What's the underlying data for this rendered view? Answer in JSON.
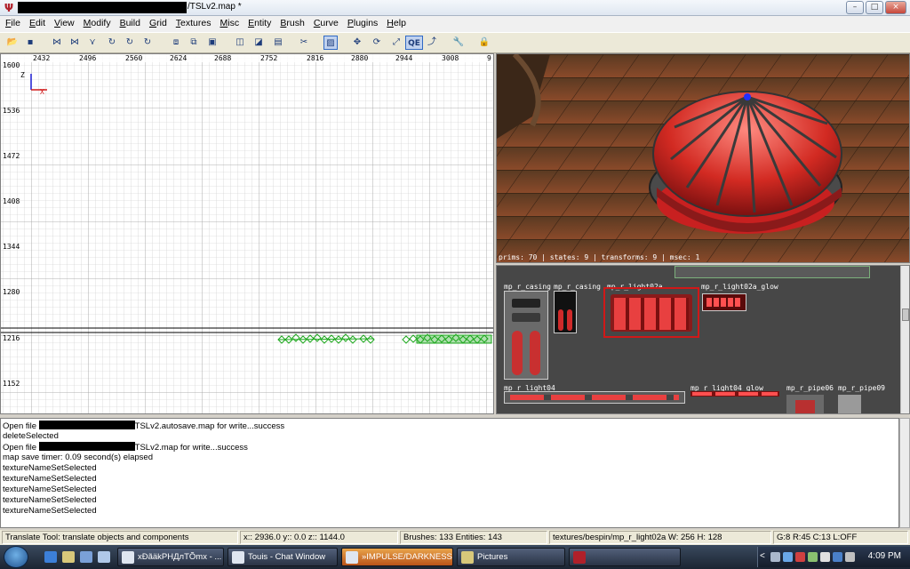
{
  "window": {
    "title": "/TSLv2.map *",
    "buttons": {
      "minimize": "–",
      "maximize": "□",
      "close": "×"
    }
  },
  "menu": [
    "File",
    "Edit",
    "View",
    "Modify",
    "Build",
    "Grid",
    "Textures",
    "Misc",
    "Entity",
    "Brush",
    "Curve",
    "Plugins",
    "Help"
  ],
  "toolbar": {
    "icons": [
      "open-icon",
      "save-icon",
      "flip-x-icon",
      "flip-y-icon",
      "flip-z-icon",
      "rotate-x-icon",
      "rotate-y-icon",
      "rotate-z-icon",
      "select-complete-tall-icon",
      "select-touching-icon",
      "select-inside-icon",
      "csg-subtract-icon",
      "csg-merge-icon",
      "make-hollow-icon",
      "clipper-icon",
      "camera-view-icon",
      "translate-icon",
      "rotate-icon",
      "scale-icon",
      "qe-mode-icon",
      "drag-vertices-icon",
      "texture-lock-icon",
      "plugin-icon"
    ],
    "qe_label": "QE"
  },
  "grid_view": {
    "axis_label_z": "Z",
    "axis_label_x": "X",
    "top_ticks": [
      "2432",
      "2496",
      "2560",
      "2624",
      "2688",
      "2752",
      "2816",
      "2880",
      "2944",
      "3008",
      "9"
    ],
    "left_ticks": [
      "1600",
      "1536",
      "1472",
      "1408",
      "1344",
      "1280",
      "1216",
      "1152"
    ]
  },
  "camera_view": {
    "status": "prims: 70 | states: 9 | transforms: 9 | msec: 1"
  },
  "texture_browser": {
    "textures": [
      {
        "name": "mp_r_casing"
      },
      {
        "name": "mp_r_casing"
      },
      {
        "name": "mp_r_light02a"
      },
      {
        "name": "mp_r_light02a_glow"
      },
      {
        "name": "mp_r_light04"
      },
      {
        "name": "mp_r_light04_glow"
      },
      {
        "name": "mp_r_pipe06"
      },
      {
        "name": "mp_r_pipe09"
      }
    ],
    "selected": "mp_r_light02a",
    "selection_color": "#d01818"
  },
  "console": {
    "lines": [
      {
        "prefix": "Open file ",
        "redacted": true,
        "text": "TSLv2.autosave.map for write...success"
      },
      {
        "prefix": "",
        "redacted": false,
        "text": "deleteSelected"
      },
      {
        "prefix": "Open file ",
        "redacted": true,
        "text": "TSLv2.map for write...success"
      },
      {
        "prefix": "",
        "redacted": false,
        "text": "map save timer:  0.09 second(s) elapsed"
      },
      {
        "prefix": "",
        "redacted": false,
        "text": "textureNameSetSelected"
      },
      {
        "prefix": "",
        "redacted": false,
        "text": "textureNameSetSelected"
      },
      {
        "prefix": "",
        "redacted": false,
        "text": "textureNameSetSelected"
      },
      {
        "prefix": "",
        "redacted": false,
        "text": "textureNameSetSelected"
      },
      {
        "prefix": "",
        "redacted": false,
        "text": "textureNameSetSelected"
      }
    ]
  },
  "status_bar": {
    "tool": "Translate Tool: translate objects and components",
    "coords": "x:: 2936.0  y::    0.0  z:: 1144.0",
    "counts": "Brushes: 133 Entities: 143",
    "texture": "textures/bespin/mp_r_light02a W: 256 H: 128",
    "grid": "G:8  R:45  C:13  L:OFF"
  },
  "taskbar": {
    "tasks": [
      {
        "label": "xĐãäkPHДлTÕmx - ...",
        "active": false
      },
      {
        "label": "Touis - Chat Window",
        "active": false
      },
      {
        "label": "»IMPULSE/DARKNESS«...",
        "active": true
      },
      {
        "label": "Pictures",
        "active": false
      },
      {
        "label": "",
        "active": false
      }
    ],
    "clock": "4:09 PM",
    "tray_chevron": "<"
  }
}
